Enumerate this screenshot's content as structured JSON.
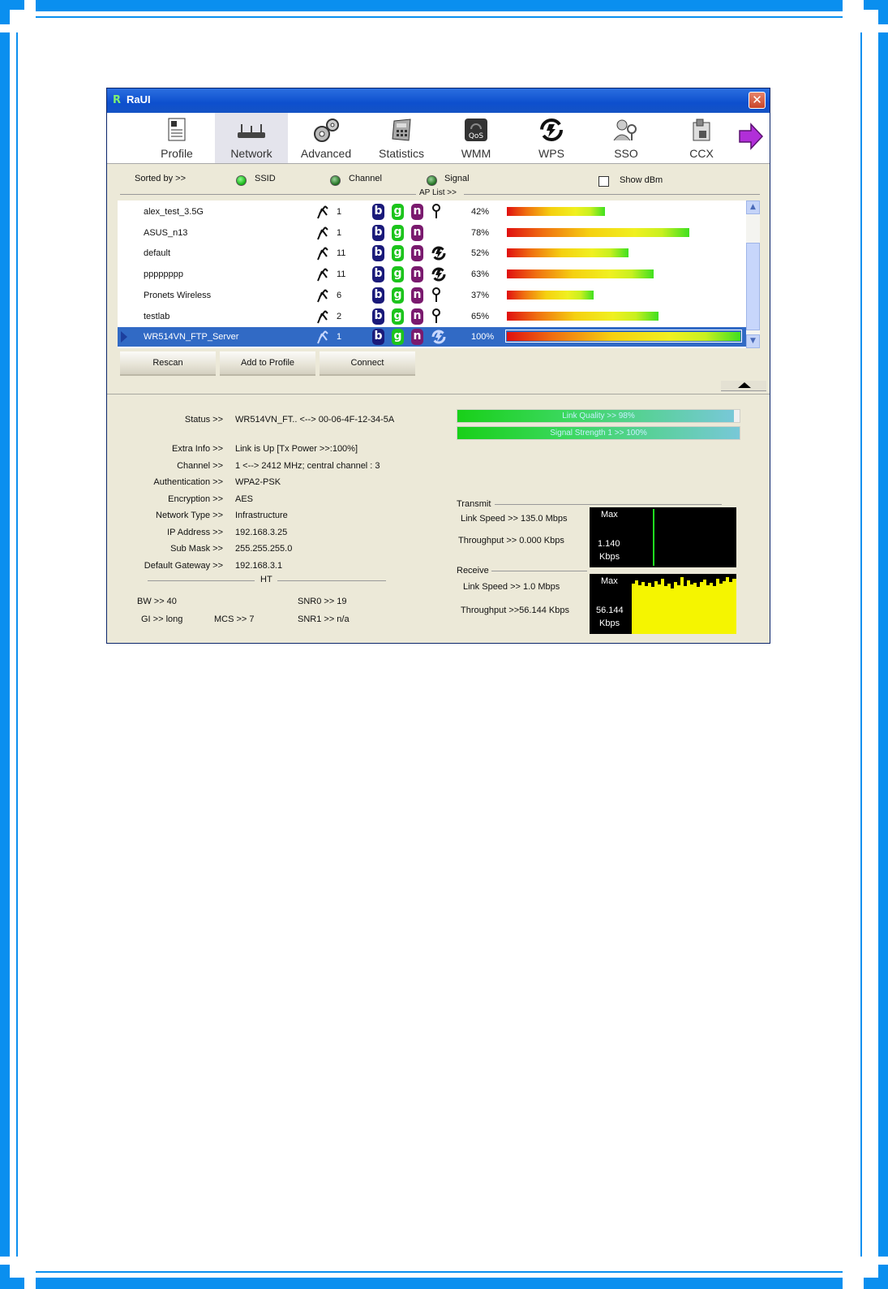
{
  "window": {
    "title": "RaUI",
    "close_icon": "close-icon"
  },
  "toolbar": {
    "items": [
      {
        "label": "Profile",
        "icon": "profile-icon"
      },
      {
        "label": "Network",
        "icon": "network-icon"
      },
      {
        "label": "Advanced",
        "icon": "advanced-icon"
      },
      {
        "label": "Statistics",
        "icon": "statistics-icon"
      },
      {
        "label": "WMM",
        "icon": "wmm-icon"
      },
      {
        "label": "WPS",
        "icon": "wps-icon"
      },
      {
        "label": "SSO",
        "icon": "sso-icon"
      },
      {
        "label": "CCX",
        "icon": "ccx-icon"
      }
    ],
    "active": "Network"
  },
  "sort": {
    "label": "Sorted by >>",
    "ssid": "SSID",
    "channel": "Channel",
    "signal": "Signal",
    "show_dbm": "Show dBm",
    "ap_list": "AP List >>"
  },
  "aps": [
    {
      "ssid": "alex_test_3.5G",
      "channel": "1",
      "b": "b",
      "g": "g",
      "n": "n",
      "security": "key",
      "signal": "42%",
      "signal_value": 42
    },
    {
      "ssid": "ASUS_n13",
      "channel": "1",
      "b": "b",
      "g": "g",
      "n": "n",
      "security": "",
      "signal": "78%",
      "signal_value": 78
    },
    {
      "ssid": "default",
      "channel": "11",
      "b": "b",
      "g": "g",
      "n": "n",
      "security": "wps",
      "signal": "52%",
      "signal_value": 52
    },
    {
      "ssid": "pppppppp",
      "channel": "11",
      "b": "b",
      "g": "g",
      "n": "n",
      "security": "wps",
      "signal": "63%",
      "signal_value": 63
    },
    {
      "ssid": "Pronets Wireless",
      "channel": "6",
      "b": "b",
      "g": "g",
      "n": "n",
      "security": "key",
      "signal": "37%",
      "signal_value": 37
    },
    {
      "ssid": "testlab",
      "channel": "2",
      "b": "b",
      "g": "g",
      "n": "n",
      "security": "key",
      "signal": "65%",
      "signal_value": 65
    },
    {
      "ssid": "WR514VN_FTP_Server",
      "channel": "1",
      "b": "b",
      "g": "g",
      "n": "n",
      "security": "wps",
      "signal": "100%",
      "signal_value": 100
    }
  ],
  "buttons": {
    "rescan": "Rescan",
    "add_to_profile": "Add to Profile",
    "connect": "Connect"
  },
  "status": {
    "status_label": "Status >>",
    "status": "WR514VN_FT.. <--> 00-06-4F-12-34-5A",
    "extra_label": "Extra Info >>",
    "extra": "Link is Up [Tx Power >>:100%]",
    "channel_label": "Channel >>",
    "channel": "1 <--> 2412 MHz; central channel : 3",
    "auth_label": "Authentication >>",
    "auth": "WPA2-PSK",
    "enc_label": "Encryption >>",
    "enc": "AES",
    "nettype_label": "Network Type >>",
    "nettype": "Infrastructure",
    "ip_label": "IP Address >>",
    "ip": "192.168.3.25",
    "mask_label": "Sub Mask >>",
    "mask": "255.255.255.0",
    "gw_label": "Default Gateway >>",
    "gw": "192.168.3.1"
  },
  "ht": {
    "title": "HT",
    "bw": "BW >>  40",
    "gi": "GI >>  long",
    "mcs": "MCS >>   7",
    "snr0": "SNR0 >>  19",
    "snr1": "SNR1 >>  n/a"
  },
  "quality": {
    "link_quality": "Link Quality >> 98%",
    "link_quality_value": 98,
    "signal_strength": "Signal Strength 1 >> 100%",
    "signal_strength_value": 100
  },
  "transmit": {
    "title": "Transmit",
    "link_speed": "Link Speed >>  135.0 Mbps",
    "throughput": "Throughput >> 0.000 Kbps",
    "graph_max": "Max",
    "graph_value": "1.140",
    "graph_unit": "Kbps"
  },
  "receive": {
    "title": "Receive",
    "link_speed": "Link Speed >> 1.0 Mbps",
    "throughput": "Throughput >>56.144 Kbps",
    "graph_max": "Max",
    "graph_value": "56.144",
    "graph_unit": "Kbps"
  }
}
